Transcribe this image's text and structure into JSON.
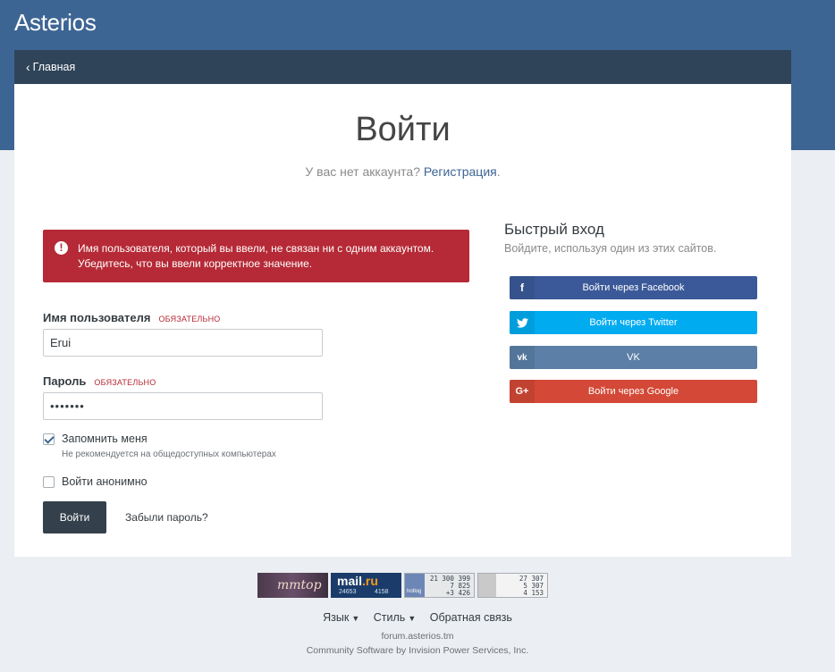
{
  "site": {
    "title": "Asterios"
  },
  "breadcrumb": {
    "home_label": "Главная"
  },
  "login": {
    "title": "Войти",
    "no_account_text": "У вас нет аккаунта?",
    "register_link": "Регистрация",
    "register_suffix": ".",
    "error_line1": "Имя пользователя, который вы ввели, не связан ни с одним аккаунтом.",
    "error_line2": "Убедитесь, что вы ввели корректное значение.",
    "username_label": "Имя пользователя",
    "username_required": "ОБЯЗАТЕЛЬНО",
    "username_value": "Erui",
    "password_label": "Пароль",
    "password_required": "ОБЯЗАТЕЛЬНО",
    "password_value": "•••••••",
    "remember_label": "Запомнить меня",
    "remember_checked": true,
    "remember_hint": "Не рекомендуется на общедоступных компьютерах",
    "anonymous_label": "Войти анонимно",
    "anonymous_checked": false,
    "submit_label": "Войти",
    "forgot_label": "Забыли пароль?"
  },
  "quick_login": {
    "title": "Быстрый вход",
    "subtitle": "Войдите, используя один из этих сайтов.",
    "facebook": {
      "label": "Войти через Facebook",
      "icon": "facebook-icon",
      "color": "#3b5998"
    },
    "twitter": {
      "label": "Войти через Twitter",
      "icon": "twitter-icon",
      "color": "#00abf0"
    },
    "vk": {
      "label": "VK",
      "icon": "vk-icon",
      "color": "#5b7fa6"
    },
    "google": {
      "label": "Войти через Google",
      "icon": "google-plus-icon",
      "color": "#d34836"
    }
  },
  "counters": {
    "mmtop": {
      "logo": "mmtop"
    },
    "mail": {
      "logo_main": "mail",
      "logo_suffix": ".ru",
      "n1": "24653",
      "n2": "4158"
    },
    "hotlog": {
      "label": "hotlog",
      "v1": "21 300 399",
      "v2": "7 825",
      "v3": "+3 426"
    },
    "liveinternet": {
      "v1": "27 307",
      "v2": "5 307",
      "v3": "4 153"
    }
  },
  "footer": {
    "language_label": "Язык",
    "style_label": "Стиль",
    "feedback_label": "Обратная связь",
    "site": "forum.asterios.tm",
    "copyright": "Community Software by Invision Power Services, Inc."
  },
  "colors": {
    "header": "#3d6594",
    "breadcrumb_bar": "#2f4459",
    "error": "#b52a36",
    "submit": "#34404b"
  }
}
